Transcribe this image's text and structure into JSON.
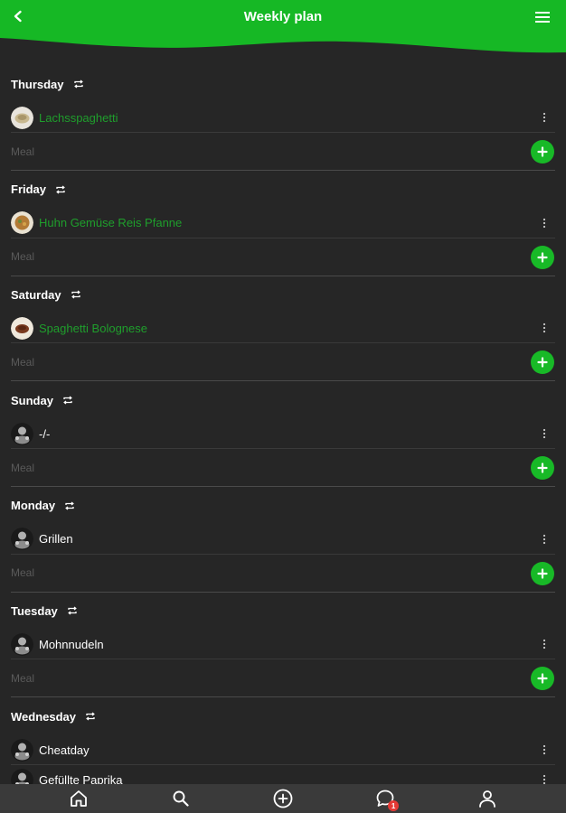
{
  "header": {
    "title": "Weekly plan",
    "back_icon": "chevron-left-icon",
    "menu_icon": "hamburger-menu-icon",
    "color": "#16b825"
  },
  "add_placeholder": "Meal",
  "days": [
    {
      "name": "Thursday",
      "meals": [
        {
          "name": "Lachsspaghetti",
          "linked": true,
          "thumb": "pasta"
        }
      ]
    },
    {
      "name": "Friday",
      "meals": [
        {
          "name": "Huhn Gemüse Reis Pfanne",
          "linked": true,
          "thumb": "pan"
        }
      ]
    },
    {
      "name": "Saturday",
      "meals": [
        {
          "name": "Spaghetti Bolognese",
          "linked": true,
          "thumb": "bolognese"
        }
      ]
    },
    {
      "name": "Sunday",
      "meals": [
        {
          "name": "-/-",
          "linked": false,
          "thumb": "placeholder"
        }
      ]
    },
    {
      "name": "Monday",
      "meals": [
        {
          "name": "Grillen",
          "linked": false,
          "thumb": "placeholder"
        }
      ]
    },
    {
      "name": "Tuesday",
      "meals": [
        {
          "name": "Mohnnudeln",
          "linked": false,
          "thumb": "placeholder"
        }
      ]
    },
    {
      "name": "Wednesday",
      "meals": [
        {
          "name": "Cheatday",
          "linked": false,
          "thumb": "placeholder"
        },
        {
          "name": "Gefüllte Paprika",
          "linked": false,
          "thumb": "placeholder"
        }
      ]
    }
  ],
  "bottom_nav": {
    "items": [
      {
        "icon": "home-icon"
      },
      {
        "icon": "search-icon"
      },
      {
        "icon": "add-circle-icon"
      },
      {
        "icon": "chat-icon",
        "badge": "1"
      },
      {
        "icon": "profile-icon"
      }
    ]
  },
  "colors": {
    "accent": "#18b927",
    "linked_text": "#1f9e2c",
    "background": "#262626",
    "nav_background": "#3a3a3a",
    "badge": "#e53935"
  }
}
